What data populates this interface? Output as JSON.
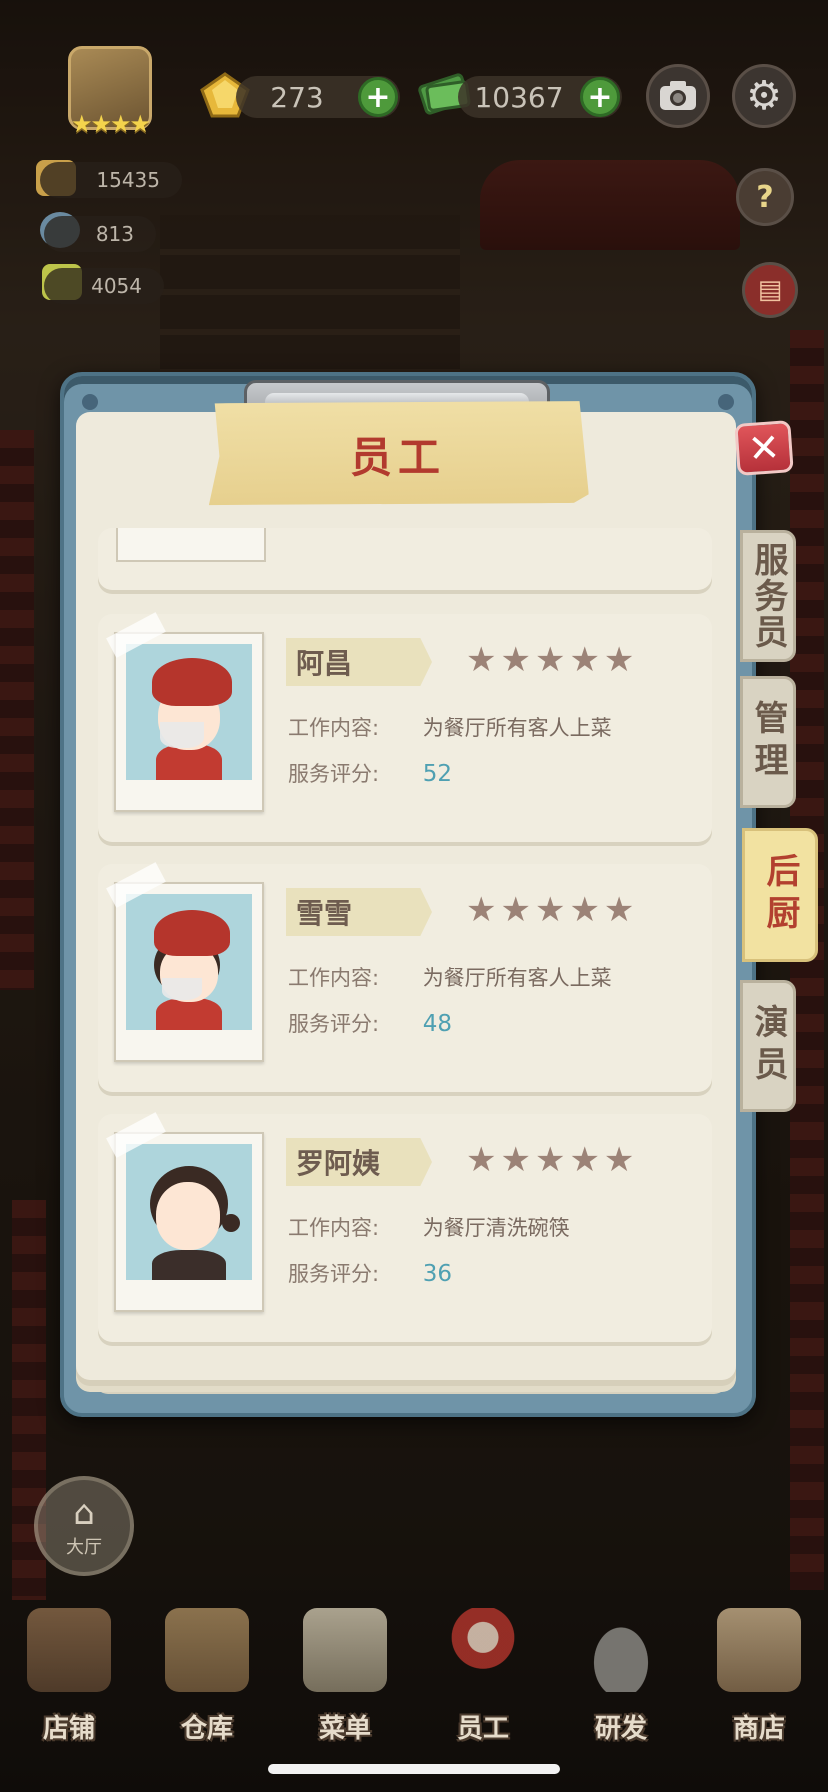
{
  "hud": {
    "gems": "273",
    "cash": "10367",
    "stat1": "15435",
    "stat2": "813",
    "stat3": "4054"
  },
  "dialog": {
    "title": "员工",
    "close": "✕"
  },
  "side_tabs": [
    {
      "label": "服务员",
      "active": false
    },
    {
      "label": "管理",
      "active": false
    },
    {
      "label": "后厨",
      "active": true
    },
    {
      "label": "演员",
      "active": false
    }
  ],
  "staff": [
    {
      "name": "阿昌",
      "stars": "★★★★★",
      "job_label": "工作内容:",
      "job": "为餐厅所有客人上菜",
      "score_label": "服务评分:",
      "score": "52"
    },
    {
      "name": "雪雪",
      "stars": "★★★★★",
      "job_label": "工作内容:",
      "job": "为餐厅所有客人上菜",
      "score_label": "服务评分:",
      "score": "48"
    },
    {
      "name": "罗阿姨",
      "stars": "★★★★★",
      "job_label": "工作内容:",
      "job": "为餐厅清洗碗筷",
      "score_label": "服务评分:",
      "score": "36"
    }
  ],
  "lobby": {
    "label": "大厅"
  },
  "nav": [
    {
      "label": "店铺",
      "icon": "shop-icon"
    },
    {
      "label": "仓库",
      "icon": "warehouse-icon"
    },
    {
      "label": "菜单",
      "icon": "menu-clipboard-icon"
    },
    {
      "label": "员工",
      "icon": "staff-icon"
    },
    {
      "label": "研发",
      "icon": "wok-icon"
    },
    {
      "label": "商店",
      "icon": "store-icon"
    }
  ],
  "colors": {
    "accent_red": "#b23a2e",
    "score_blue": "#4fa0b2",
    "frame_blue": "#6f94a8",
    "plus_green": "#4e9a3b"
  }
}
